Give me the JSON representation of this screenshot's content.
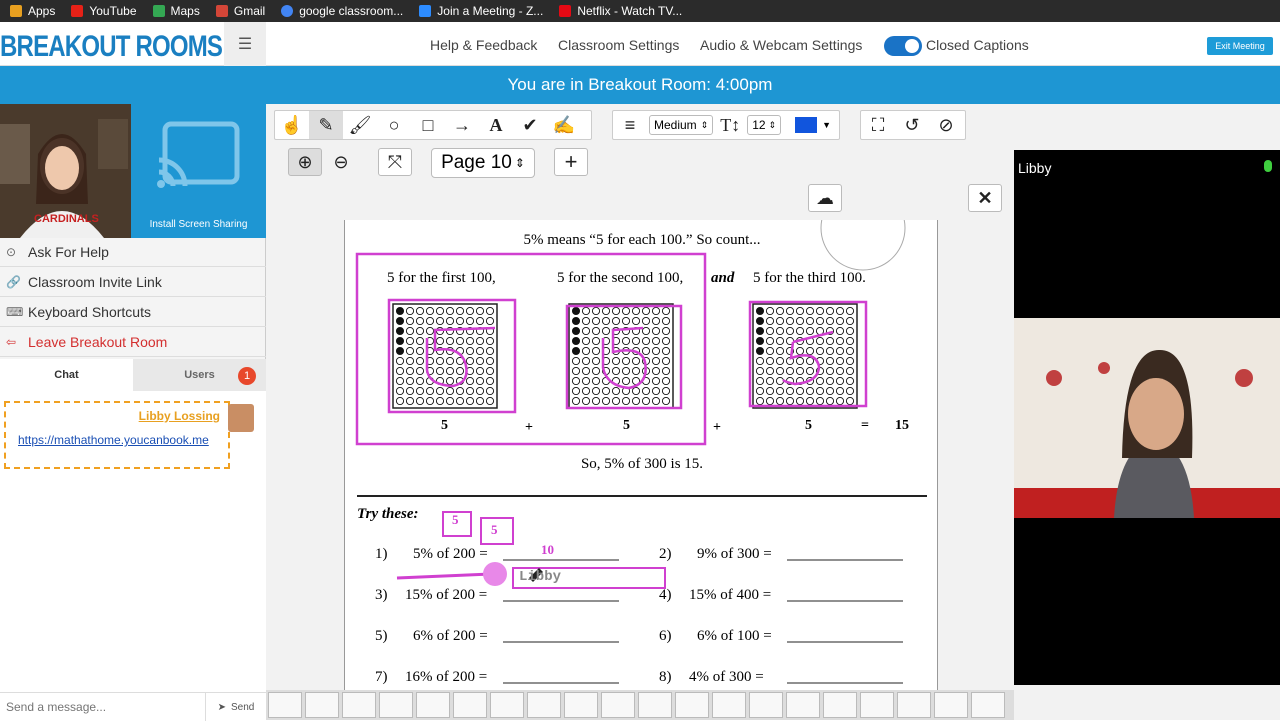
{
  "bookmarks": [
    {
      "label": "Apps",
      "color": "#e8a020"
    },
    {
      "label": "YouTube",
      "color": "#e62117"
    },
    {
      "label": "Maps",
      "color": "#34a853"
    },
    {
      "label": "Gmail",
      "color": "#d44638"
    },
    {
      "label": "google classroom...",
      "color": "#4285f4"
    },
    {
      "label": "Join a Meeting - Z...",
      "color": "#2d8cff"
    },
    {
      "label": "Netflix - Watch TV...",
      "color": "#e50914"
    }
  ],
  "header": {
    "logo": "BREAKOUT ROOMS",
    "menu_icon": "☰",
    "nav": [
      "Help & Feedback",
      "Classroom Settings",
      "Audio & Webcam Settings"
    ],
    "closed_captions": "Closed Captions",
    "exit": "Exit Meeting"
  },
  "banner": "You are in Breakout Room: 4:00pm",
  "left": {
    "install": "Install Screen Sharing",
    "menu": [
      "Ask For Help",
      "Classroom Invite Link",
      "Keyboard Shortcuts",
      "Leave Breakout Room"
    ],
    "tabs": [
      "Chat",
      "Users"
    ],
    "users_badge": "1",
    "message": {
      "name": "Libby Lossing",
      "link": "https://mathathome.youcanbook.me"
    },
    "send_placeholder": "Send a message...",
    "send": "Send"
  },
  "toolbar": {
    "stroke": "Medium",
    "font_size": "12",
    "page": "Page 10",
    "color": "#1155dd"
  },
  "doc": {
    "heading": "5% means “5 for each 100.” So count...",
    "first": "5 for the first 100,",
    "second": "5 for the second 100,",
    "and": "and",
    "third": "5 for the third 100.",
    "values": [
      "5",
      "+",
      "5",
      "+",
      "5",
      "=",
      "15"
    ],
    "so": "So, 5% of 300 is 15.",
    "try": "Try these:",
    "annot_boxes": [
      "5",
      "5"
    ],
    "annot_10": "10",
    "annot_libby": "Libby",
    "problems": [
      {
        "n": "1)",
        "q": "5% of 200 ="
      },
      {
        "n": "2)",
        "q": "9% of 300 ="
      },
      {
        "n": "3)",
        "q": "15% of 200 ="
      },
      {
        "n": "4)",
        "q": "15% of 400 ="
      },
      {
        "n": "5)",
        "q": "6% of 200 ="
      },
      {
        "n": "6)",
        "q": "6% of 100 ="
      },
      {
        "n": "7)",
        "q": "16% of 200 ="
      },
      {
        "n": "8)",
        "q": "4% of 300 ="
      }
    ]
  },
  "right": {
    "name": "Libby"
  }
}
